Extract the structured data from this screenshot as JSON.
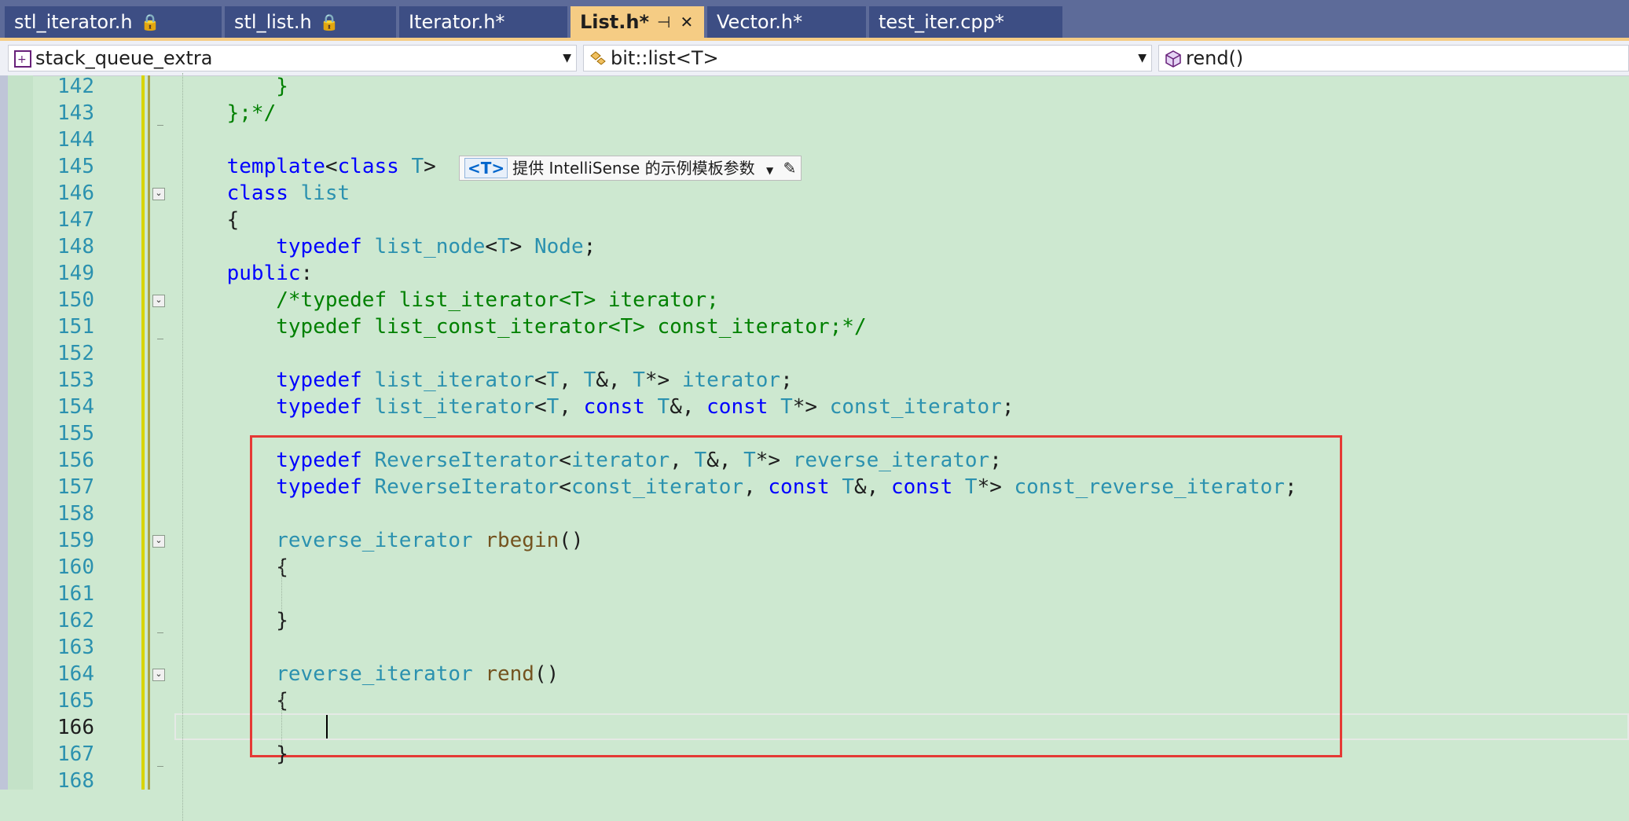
{
  "tabs": [
    {
      "label": "stl_iterator.h",
      "locked": true
    },
    {
      "label": "stl_list.h",
      "locked": true
    },
    {
      "label": "Iterator.h*"
    },
    {
      "label": "List.h*",
      "active": true
    },
    {
      "label": "Vector.h*"
    },
    {
      "label": "test_iter.cpp*"
    }
  ],
  "navbar": {
    "project": "stack_queue_extra",
    "scope": "bit::list<T>",
    "member": "rend()"
  },
  "hint": {
    "tag": "<T>",
    "text": "提供 IntelliSense 的示例模板参数"
  },
  "colors": {
    "keyword": "#0000ff",
    "type": "#2b91af",
    "comment": "#008000",
    "function": "#74531f",
    "highlight": "#e53935",
    "editor_bg": "#cde8d0"
  },
  "current_line": 166,
  "lines": [
    {
      "n": 142,
      "tokens": [
        [
          "        ",
          ""
        ],
        [
          "}",
          "cm"
        ]
      ]
    },
    {
      "n": 143,
      "tokens": [
        [
          "    ",
          ""
        ],
        [
          "};*/",
          "cm"
        ]
      ]
    },
    {
      "n": 144,
      "tokens": []
    },
    {
      "n": 145,
      "tokens": [
        [
          "    ",
          ""
        ],
        [
          "template",
          "kw"
        ],
        [
          "<",
          ""
        ],
        [
          "class",
          "kw"
        ],
        [
          " ",
          ""
        ],
        [
          "T",
          "ty"
        ],
        [
          ">",
          ""
        ]
      ]
    },
    {
      "n": 146,
      "tokens": [
        [
          "    ",
          ""
        ],
        [
          "class",
          "kw"
        ],
        [
          " ",
          ""
        ],
        [
          "list",
          "ty"
        ]
      ]
    },
    {
      "n": 147,
      "tokens": [
        [
          "    {",
          ""
        ]
      ]
    },
    {
      "n": 148,
      "tokens": [
        [
          "        ",
          ""
        ],
        [
          "typedef",
          "kw"
        ],
        [
          " ",
          ""
        ],
        [
          "list_node",
          "ty"
        ],
        [
          "<",
          ""
        ],
        [
          "T",
          "ty"
        ],
        [
          "> ",
          ""
        ],
        [
          "Node",
          "ty"
        ],
        [
          ";",
          ""
        ]
      ]
    },
    {
      "n": 149,
      "tokens": [
        [
          "    ",
          ""
        ],
        [
          "public",
          "kw"
        ],
        [
          ":",
          ""
        ]
      ]
    },
    {
      "n": 150,
      "tokens": [
        [
          "        ",
          ""
        ],
        [
          "/*typedef list_iterator<T> iterator;",
          "cm"
        ]
      ]
    },
    {
      "n": 151,
      "tokens": [
        [
          "        ",
          ""
        ],
        [
          "typedef list_const_iterator<T> const_iterator;*/",
          "cm"
        ]
      ]
    },
    {
      "n": 152,
      "tokens": []
    },
    {
      "n": 153,
      "tokens": [
        [
          "        ",
          ""
        ],
        [
          "typedef",
          "kw"
        ],
        [
          " ",
          ""
        ],
        [
          "list_iterator",
          "ty"
        ],
        [
          "<",
          ""
        ],
        [
          "T",
          "ty"
        ],
        [
          ", ",
          ""
        ],
        [
          "T",
          "ty"
        ],
        [
          "&, ",
          ""
        ],
        [
          "T",
          "ty"
        ],
        [
          "*> ",
          ""
        ],
        [
          "iterator",
          "ty"
        ],
        [
          ";",
          ""
        ]
      ]
    },
    {
      "n": 154,
      "tokens": [
        [
          "        ",
          ""
        ],
        [
          "typedef",
          "kw"
        ],
        [
          " ",
          ""
        ],
        [
          "list_iterator",
          "ty"
        ],
        [
          "<",
          ""
        ],
        [
          "T",
          "ty"
        ],
        [
          ", ",
          ""
        ],
        [
          "const",
          "kw"
        ],
        [
          " ",
          ""
        ],
        [
          "T",
          "ty"
        ],
        [
          "&, ",
          ""
        ],
        [
          "const",
          "kw"
        ],
        [
          " ",
          ""
        ],
        [
          "T",
          "ty"
        ],
        [
          "*> ",
          ""
        ],
        [
          "const_iterator",
          "ty"
        ],
        [
          ";",
          ""
        ]
      ]
    },
    {
      "n": 155,
      "tokens": []
    },
    {
      "n": 156,
      "tokens": [
        [
          "        ",
          ""
        ],
        [
          "typedef",
          "kw"
        ],
        [
          " ",
          ""
        ],
        [
          "ReverseIterator",
          "ty"
        ],
        [
          "<",
          ""
        ],
        [
          "iterator",
          "ty"
        ],
        [
          ", ",
          ""
        ],
        [
          "T",
          "ty"
        ],
        [
          "&, ",
          ""
        ],
        [
          "T",
          "ty"
        ],
        [
          "*> ",
          ""
        ],
        [
          "reverse_iterator",
          "ty"
        ],
        [
          ";",
          ""
        ]
      ]
    },
    {
      "n": 157,
      "tokens": [
        [
          "        ",
          ""
        ],
        [
          "typedef",
          "kw"
        ],
        [
          " ",
          ""
        ],
        [
          "ReverseIterator",
          "ty"
        ],
        [
          "<",
          ""
        ],
        [
          "const_iterator",
          "ty"
        ],
        [
          ", ",
          ""
        ],
        [
          "const",
          "kw"
        ],
        [
          " ",
          ""
        ],
        [
          "T",
          "ty"
        ],
        [
          "&, ",
          ""
        ],
        [
          "const",
          "kw"
        ],
        [
          " ",
          ""
        ],
        [
          "T",
          "ty"
        ],
        [
          "*> ",
          ""
        ],
        [
          "const_reverse_iterator",
          "ty"
        ],
        [
          ";",
          ""
        ]
      ]
    },
    {
      "n": 158,
      "tokens": []
    },
    {
      "n": 159,
      "tokens": [
        [
          "        ",
          ""
        ],
        [
          "reverse_iterator",
          "ty"
        ],
        [
          " ",
          ""
        ],
        [
          "rbegin",
          "fn"
        ],
        [
          "()",
          ""
        ]
      ]
    },
    {
      "n": 160,
      "tokens": [
        [
          "        {",
          ""
        ]
      ]
    },
    {
      "n": 161,
      "tokens": []
    },
    {
      "n": 162,
      "tokens": [
        [
          "        }",
          ""
        ]
      ]
    },
    {
      "n": 163,
      "tokens": []
    },
    {
      "n": 164,
      "tokens": [
        [
          "        ",
          ""
        ],
        [
          "reverse_iterator",
          "ty"
        ],
        [
          " ",
          ""
        ],
        [
          "rend",
          "fn"
        ],
        [
          "()",
          ""
        ]
      ]
    },
    {
      "n": 165,
      "tokens": [
        [
          "        {",
          ""
        ]
      ]
    },
    {
      "n": 166,
      "tokens": []
    },
    {
      "n": 167,
      "tokens": [
        [
          "        }",
          ""
        ]
      ]
    },
    {
      "n": 168,
      "tokens": []
    }
  ]
}
